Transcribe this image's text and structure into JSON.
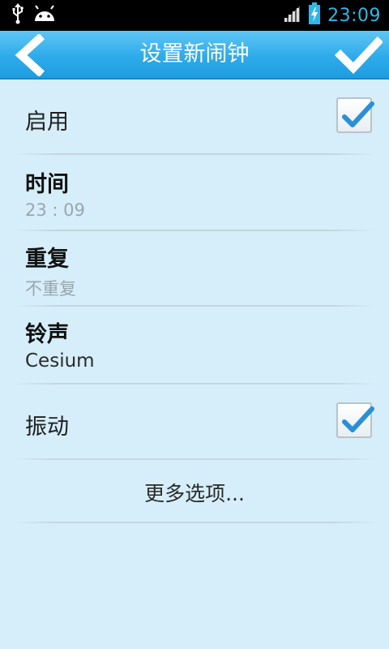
{
  "status_bar": {
    "time": "23:09",
    "icons": [
      "usb-icon",
      "android-debug-icon",
      "signal-icon",
      "battery-charging-icon"
    ]
  },
  "header": {
    "title": "设置新闹钟",
    "back_icon": "back-arrow-icon",
    "confirm_icon": "checkmark-icon"
  },
  "settings": {
    "enable": {
      "label": "启用",
      "checked": true
    },
    "time": {
      "label": "时间",
      "value": "23 : 09"
    },
    "repeat": {
      "label": "重复",
      "value": "不重复"
    },
    "ringtone": {
      "label": "铃声",
      "value": "Cesium"
    },
    "vibrate": {
      "label": "振动",
      "checked": true
    },
    "more_label": "更多选项..."
  },
  "colors": {
    "header": "#2eabea",
    "background": "#d5eef9",
    "check": "#2b8fd6",
    "time_text": "#2fb6ea"
  }
}
